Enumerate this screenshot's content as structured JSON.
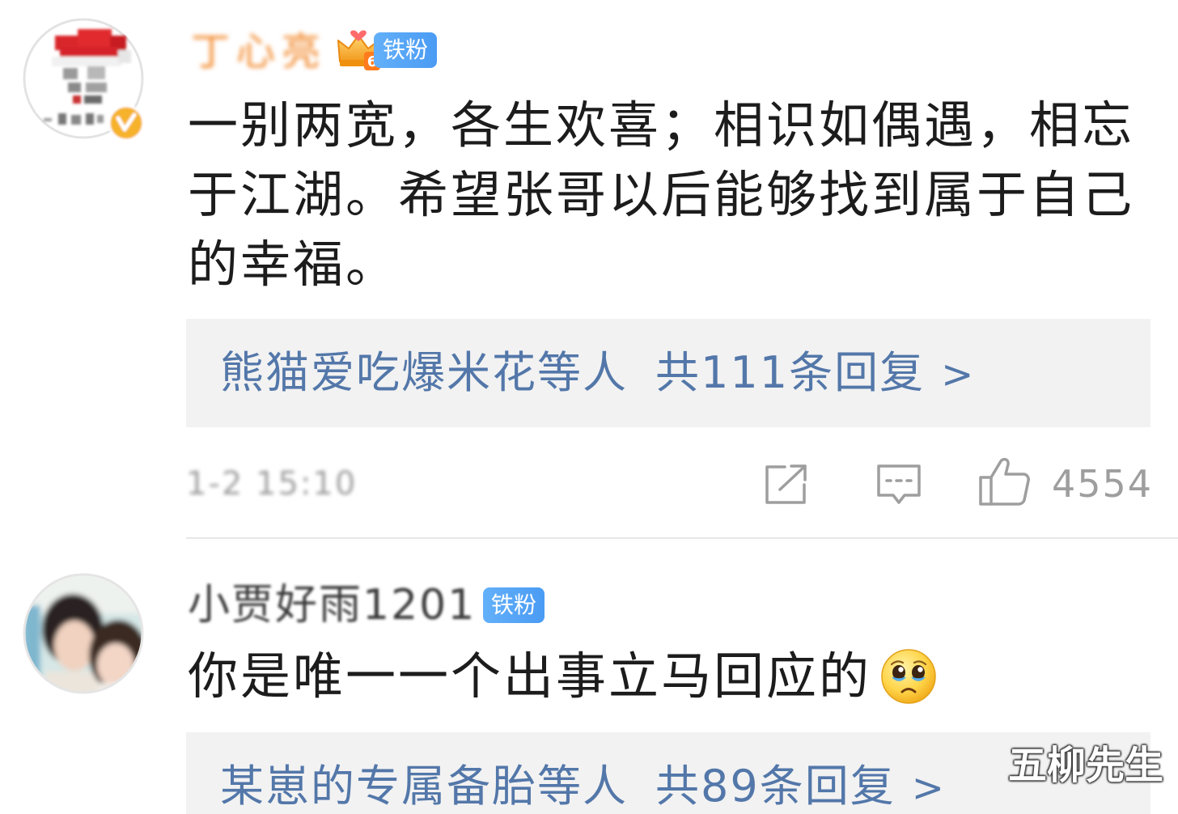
{
  "comments": [
    {
      "username": "丁心亮",
      "level": "6",
      "fan_badge": "铁粉",
      "text": "一别两宽，各生欢喜；相识如偶遇，相忘于江湖。希望张哥以后能够找到属于自己的幸福。",
      "reply_preview": {
        "names": "熊猫爱吃爆米花等人",
        "count": "共111条回复",
        "arrow": ">"
      },
      "time": "1-2 15:10",
      "likes": "4554"
    },
    {
      "username": "小贾好雨1201",
      "fan_badge": "铁粉",
      "text": "你是唯一一个出事立马回应的",
      "emoji": "crying-face-icon",
      "reply_preview": {
        "names": "某崽的专属备胎等人",
        "count": "共89条回复",
        "arrow": ">"
      }
    }
  ],
  "icons": {
    "forward": "share-icon",
    "comment": "comment-icon",
    "like": "thumbs-up-icon",
    "level_badge": "crown-icon",
    "verified": "vip-badge-icon"
  },
  "watermark": "五柳先生",
  "colors": {
    "text": "#1c1c1c",
    "meta": "#9e9e9e",
    "reply_link": "#5377a9",
    "reply_background": "#f2f2f2",
    "fan_badge": "#4a9bf4",
    "vip_username": "#f28a2e",
    "username": "#3a3a3a",
    "divider": "#e6e6e6"
  }
}
